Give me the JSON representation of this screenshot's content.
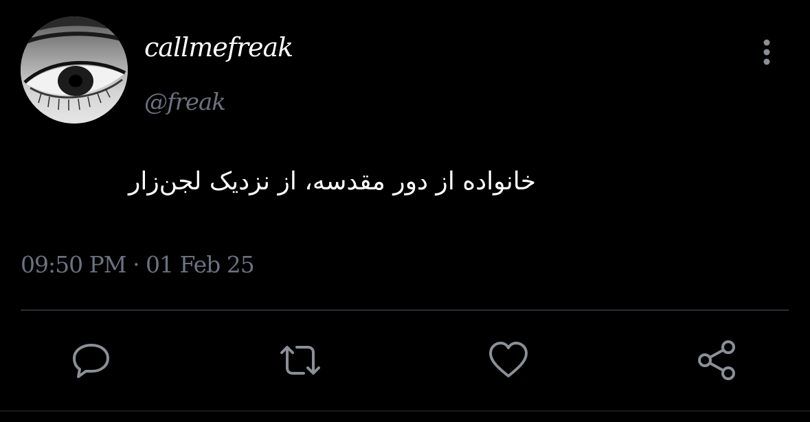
{
  "user": {
    "display_name": "callmefreak",
    "handle": "@freak"
  },
  "tweet": {
    "text": "خانواده از دور مقدسه، از نزدیک لجن‌زار",
    "timestamp": "09:50 PM · 01 Feb 25"
  },
  "icons": {
    "more": "more-vertical-icon",
    "reply": "comment-icon",
    "retweet": "retweet-icon",
    "like": "heart-icon",
    "share": "share-icon"
  },
  "colors": {
    "background": "#000000",
    "text": "#ffffff",
    "muted": "#6b7280",
    "divider": "#2b2f36"
  }
}
